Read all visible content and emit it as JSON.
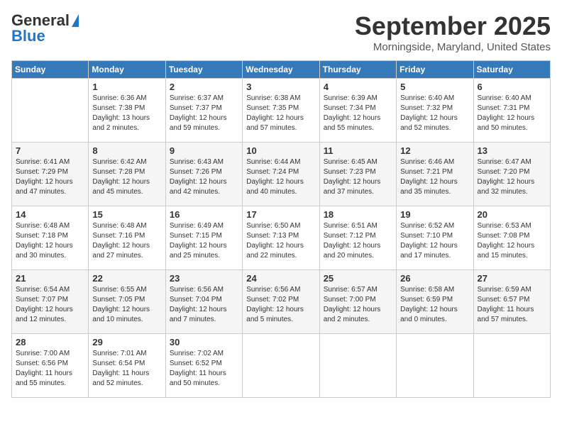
{
  "header": {
    "logo_general": "General",
    "logo_blue": "Blue",
    "month_title": "September 2025",
    "location": "Morningside, Maryland, United States"
  },
  "days_of_week": [
    "Sunday",
    "Monday",
    "Tuesday",
    "Wednesday",
    "Thursday",
    "Friday",
    "Saturday"
  ],
  "weeks": [
    [
      {
        "day": "",
        "info": ""
      },
      {
        "day": "1",
        "info": "Sunrise: 6:36 AM\nSunset: 7:38 PM\nDaylight: 13 hours\nand 2 minutes."
      },
      {
        "day": "2",
        "info": "Sunrise: 6:37 AM\nSunset: 7:37 PM\nDaylight: 12 hours\nand 59 minutes."
      },
      {
        "day": "3",
        "info": "Sunrise: 6:38 AM\nSunset: 7:35 PM\nDaylight: 12 hours\nand 57 minutes."
      },
      {
        "day": "4",
        "info": "Sunrise: 6:39 AM\nSunset: 7:34 PM\nDaylight: 12 hours\nand 55 minutes."
      },
      {
        "day": "5",
        "info": "Sunrise: 6:40 AM\nSunset: 7:32 PM\nDaylight: 12 hours\nand 52 minutes."
      },
      {
        "day": "6",
        "info": "Sunrise: 6:40 AM\nSunset: 7:31 PM\nDaylight: 12 hours\nand 50 minutes."
      }
    ],
    [
      {
        "day": "7",
        "info": "Sunrise: 6:41 AM\nSunset: 7:29 PM\nDaylight: 12 hours\nand 47 minutes."
      },
      {
        "day": "8",
        "info": "Sunrise: 6:42 AM\nSunset: 7:28 PM\nDaylight: 12 hours\nand 45 minutes."
      },
      {
        "day": "9",
        "info": "Sunrise: 6:43 AM\nSunset: 7:26 PM\nDaylight: 12 hours\nand 42 minutes."
      },
      {
        "day": "10",
        "info": "Sunrise: 6:44 AM\nSunset: 7:24 PM\nDaylight: 12 hours\nand 40 minutes."
      },
      {
        "day": "11",
        "info": "Sunrise: 6:45 AM\nSunset: 7:23 PM\nDaylight: 12 hours\nand 37 minutes."
      },
      {
        "day": "12",
        "info": "Sunrise: 6:46 AM\nSunset: 7:21 PM\nDaylight: 12 hours\nand 35 minutes."
      },
      {
        "day": "13",
        "info": "Sunrise: 6:47 AM\nSunset: 7:20 PM\nDaylight: 12 hours\nand 32 minutes."
      }
    ],
    [
      {
        "day": "14",
        "info": "Sunrise: 6:48 AM\nSunset: 7:18 PM\nDaylight: 12 hours\nand 30 minutes."
      },
      {
        "day": "15",
        "info": "Sunrise: 6:48 AM\nSunset: 7:16 PM\nDaylight: 12 hours\nand 27 minutes."
      },
      {
        "day": "16",
        "info": "Sunrise: 6:49 AM\nSunset: 7:15 PM\nDaylight: 12 hours\nand 25 minutes."
      },
      {
        "day": "17",
        "info": "Sunrise: 6:50 AM\nSunset: 7:13 PM\nDaylight: 12 hours\nand 22 minutes."
      },
      {
        "day": "18",
        "info": "Sunrise: 6:51 AM\nSunset: 7:12 PM\nDaylight: 12 hours\nand 20 minutes."
      },
      {
        "day": "19",
        "info": "Sunrise: 6:52 AM\nSunset: 7:10 PM\nDaylight: 12 hours\nand 17 minutes."
      },
      {
        "day": "20",
        "info": "Sunrise: 6:53 AM\nSunset: 7:08 PM\nDaylight: 12 hours\nand 15 minutes."
      }
    ],
    [
      {
        "day": "21",
        "info": "Sunrise: 6:54 AM\nSunset: 7:07 PM\nDaylight: 12 hours\nand 12 minutes."
      },
      {
        "day": "22",
        "info": "Sunrise: 6:55 AM\nSunset: 7:05 PM\nDaylight: 12 hours\nand 10 minutes."
      },
      {
        "day": "23",
        "info": "Sunrise: 6:56 AM\nSunset: 7:04 PM\nDaylight: 12 hours\nand 7 minutes."
      },
      {
        "day": "24",
        "info": "Sunrise: 6:56 AM\nSunset: 7:02 PM\nDaylight: 12 hours\nand 5 minutes."
      },
      {
        "day": "25",
        "info": "Sunrise: 6:57 AM\nSunset: 7:00 PM\nDaylight: 12 hours\nand 2 minutes."
      },
      {
        "day": "26",
        "info": "Sunrise: 6:58 AM\nSunset: 6:59 PM\nDaylight: 12 hours\nand 0 minutes."
      },
      {
        "day": "27",
        "info": "Sunrise: 6:59 AM\nSunset: 6:57 PM\nDaylight: 11 hours\nand 57 minutes."
      }
    ],
    [
      {
        "day": "28",
        "info": "Sunrise: 7:00 AM\nSunset: 6:56 PM\nDaylight: 11 hours\nand 55 minutes."
      },
      {
        "day": "29",
        "info": "Sunrise: 7:01 AM\nSunset: 6:54 PM\nDaylight: 11 hours\nand 52 minutes."
      },
      {
        "day": "30",
        "info": "Sunrise: 7:02 AM\nSunset: 6:52 PM\nDaylight: 11 hours\nand 50 minutes."
      },
      {
        "day": "",
        "info": ""
      },
      {
        "day": "",
        "info": ""
      },
      {
        "day": "",
        "info": ""
      },
      {
        "day": "",
        "info": ""
      }
    ]
  ]
}
